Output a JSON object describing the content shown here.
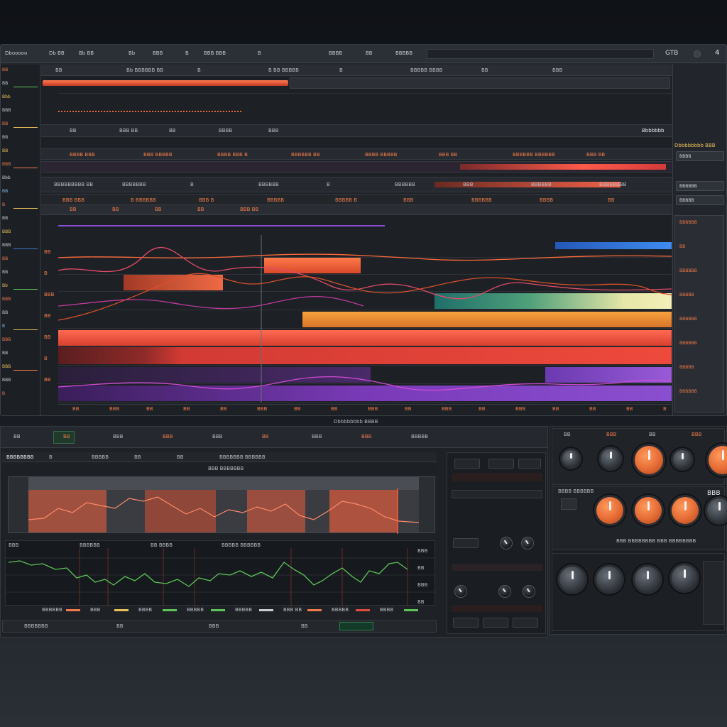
{
  "menubar": {
    "items": [
      "Dbooooo",
      "Db BB",
      "Bb BB",
      "Bb",
      "BBB",
      "B",
      "BBB BBB",
      "B",
      "BBBB",
      "BB",
      "BBBBB"
    ],
    "right": "GTB",
    "close_glyph": "4"
  },
  "left_panel": {
    "labels": [
      "BB",
      "BB",
      "Bbb",
      "BBB",
      "BB",
      "BB",
      "BB",
      "BBB",
      "Bbb",
      "BB",
      "B",
      "BB",
      "BBB",
      "BBB",
      "BB",
      "BB",
      "Bb",
      "BBB",
      "BB",
      "B",
      "BBB",
      "BB",
      "BBB",
      "BBB",
      "B"
    ]
  },
  "arrange": {
    "top_ruler": [
      "BB",
      "Bb BBBBBB BB",
      "B",
      "B BB BBBBB",
      "B",
      "BBBBB BBBB",
      "BB",
      "BBB"
    ],
    "strip1": [
      "BB",
      "BBB BB",
      "BB",
      "BBBB",
      "BBB"
    ],
    "strip1_right": [
      "Bbbbbbb",
      "BBB"
    ],
    "strip2": [
      "BBBB BBB",
      "BBB BBBBB",
      "BBBB BBB B",
      "BBBBBB BB",
      "BBBB BBBBB",
      "BBB BB",
      "BBBBBB BBBBBB",
      "BBB BB"
    ],
    "strip3": [
      "BBBBBBBBB BB",
      "BBBBBBB",
      "B",
      "BBBBBB",
      "B",
      "BBBBBB",
      "BBB",
      "BBBBBB",
      "BBBBBBBB"
    ],
    "strip4": [
      "BBB BBB",
      "B BBBBBB",
      "BBB B",
      "BBBBB",
      "BBBBB B",
      "BBB",
      "BBBBBB",
      "BBBB",
      "BB"
    ],
    "ruler2": [
      "BB",
      "BB",
      "BB",
      "BB",
      "BBB BB"
    ],
    "bottom_ruler": [
      "BB",
      "BBB",
      "BB",
      "BB",
      "BB",
      "BBB",
      "BB",
      "BB",
      "BBB",
      "BB",
      "BBB",
      "BB",
      "BBB",
      "BB",
      "BB",
      "BB",
      "B"
    ],
    "lane_markers": [
      "BB",
      "B",
      "BBB",
      "BB",
      "BB",
      "B",
      "BB"
    ]
  },
  "right_panel": {
    "title": "Dbbbbbbbb BBB",
    "buttons": [
      "BBBB",
      "BBBBBB",
      "BBBBB"
    ],
    "rows": [
      "BBBBBB",
      "BB",
      "BBBBBB",
      "BBBBB",
      "BBBBBB",
      "BBBBBB",
      "BBBBB",
      "BBBBBB"
    ]
  },
  "lower": {
    "center_title": "Dbbbbbbbb BBBB",
    "tabs": [
      "BB",
      "BB",
      "BBB",
      "BBB",
      "BBB",
      "BB",
      "BBB",
      "BBB",
      "BBBBB"
    ],
    "toolbar": [
      "BBBBBBBB",
      "B",
      "BBBBB",
      "BB",
      "BB",
      "BBBBBBB BBBBBB"
    ],
    "graph_label": "BBB BBBBBBB",
    "graph2_header": [
      "BBB",
      "BBBBBB",
      "BB BBBB",
      "BBBBB BBBBBB"
    ],
    "graph2_scale": [
      "BBB",
      "BB",
      "BBB",
      "BB"
    ],
    "meters": [
      "BBBBBB",
      "BBB",
      "BBBB",
      "BBBBB",
      "BBBBB",
      "BBB BB",
      "BBBBB",
      "BBBB"
    ],
    "transport": [
      "BBBBBBB",
      "BB",
      "BBB",
      "BB"
    ]
  },
  "knob_panel": {
    "tabs": [
      "BB",
      "BBB",
      "BB",
      "BBB"
    ],
    "row2_label": "BBBB BBBBBB",
    "caption": "BBB BBBBBBBB BBB BBBBBBBB",
    "side_label": "BBB"
  },
  "colors": {
    "accent_orange": "#f07a4a",
    "accent_red": "#e24b3e",
    "accent_yellow": "#e9d36c",
    "accent_purple": "#8a4fd0",
    "accent_blue": "#2f6fd6",
    "accent_green": "#5ec45a"
  }
}
